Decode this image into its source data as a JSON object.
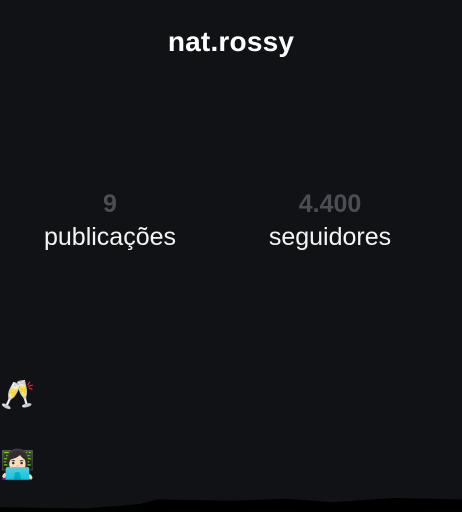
{
  "profile": {
    "username": "nat.rossy"
  },
  "stats": {
    "posts": {
      "value": "9",
      "label": "publicações"
    },
    "followers": {
      "value": "4.400",
      "label": "seguidores"
    }
  },
  "bio_emojis": {
    "toast": "🥂",
    "laptop": "👩🏻‍💻"
  },
  "colors": {
    "background": "#101216",
    "text": "#f4f4f4",
    "muted_number": "#4a4d54"
  }
}
